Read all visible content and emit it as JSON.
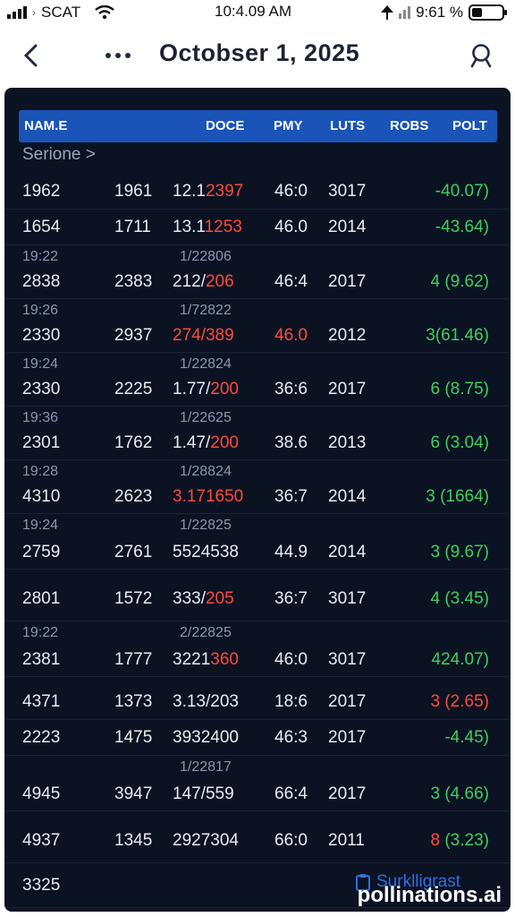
{
  "status_bar": {
    "carrier": "SCAT",
    "time": "10:4.09 AM",
    "battery_text": "9:61 %",
    "battery_level": 0.35
  },
  "nav": {
    "title": "Octobser 1, 2025"
  },
  "table": {
    "columns": [
      "NAM.E",
      "DOCE",
      "PMY",
      "LUTS",
      "ROBS",
      "POLT"
    ],
    "section_label": "Serione >",
    "rows": [
      {
        "time": "",
        "sub": "",
        "name": "1962",
        "col2": "1961",
        "price_a": "12.1",
        "price_b": "2397",
        "price_b_red": true,
        "pmy": "46:0",
        "pmy_red": false,
        "luts": "3017",
        "polt_a": "",
        "polt_b": "-40.07)",
        "polt_b_color": "green"
      },
      {
        "time": "",
        "sub": "",
        "name": "1654",
        "col2": "1711",
        "price_a": "13.1",
        "price_b": "1253",
        "price_b_red": true,
        "pmy": "46.0",
        "pmy_red": false,
        "luts": "2014",
        "polt_a": "",
        "polt_b": "-43.64)",
        "polt_b_color": "green"
      },
      {
        "time": "19:22",
        "sub": "1/22806",
        "name": "2838",
        "col2": "2383",
        "price_a": "212/",
        "price_b": "206",
        "price_b_red": true,
        "pmy": "46:4",
        "pmy_red": false,
        "luts": "2017",
        "polt_a": "4",
        "polt_a_color": "green",
        "polt_b": " (9.62)",
        "polt_b_color": "green"
      },
      {
        "time": "19:26",
        "sub": "1/72822",
        "name": "2330",
        "col2": "2937",
        "price_a": "",
        "price_b": "274/389",
        "price_b_red": true,
        "pmy": "46.0",
        "pmy_red": true,
        "luts": "2012",
        "polt_a": "3",
        "polt_a_color": "green",
        "polt_b": "(61.46)",
        "polt_b_color": "green"
      },
      {
        "time": "19:24",
        "sub": "1/22824",
        "name": "2330",
        "col2": "2225",
        "price_a": "1.77/",
        "price_b": "200",
        "price_b_red": true,
        "pmy": "36:6",
        "pmy_red": false,
        "luts": "2017",
        "polt_a": "6",
        "polt_a_color": "green",
        "polt_b": " (8.75)",
        "polt_b_color": "green"
      },
      {
        "time": "19:36",
        "sub": "1/22625",
        "name": "2301",
        "col2": "1762",
        "price_a": "1.47/",
        "price_b": "200",
        "price_b_red": true,
        "pmy": "38.6",
        "pmy_red": false,
        "luts": "2013",
        "polt_a": "6",
        "polt_a_color": "green",
        "polt_b": " (3.04)",
        "polt_b_color": "green"
      },
      {
        "time": "19:28",
        "sub": "1/28824",
        "name": "4310",
        "col2": "2623",
        "price_a": "",
        "price_b": "3.171650",
        "price_b_red": true,
        "pmy": "36:7",
        "pmy_red": false,
        "luts": "2014",
        "polt_a": "3",
        "polt_a_color": "green",
        "polt_b": " (1664)",
        "polt_b_color": "green"
      },
      {
        "time": "19:24",
        "sub": "1/22825",
        "name": "2759",
        "col2": "2761",
        "price_a": "5524538",
        "price_b": "",
        "price_b_red": false,
        "pmy": "44.9",
        "pmy_red": false,
        "luts": "2014",
        "polt_a": "3",
        "polt_a_color": "green",
        "polt_b": " (9.67)",
        "polt_b_color": "green"
      },
      {
        "time": "",
        "sub": "",
        "name": "2801",
        "col2": "1572",
        "price_a": "333/",
        "price_b": "205",
        "price_b_red": true,
        "pmy": "36:7",
        "pmy_red": false,
        "luts": "3017",
        "polt_a": "4",
        "polt_a_color": "green",
        "polt_b": " (3.45)",
        "polt_b_color": "green"
      },
      {
        "time": "19:22",
        "sub": "2/22825",
        "name": "2381",
        "col2": "1777",
        "price_a": "3221",
        "price_b": "360",
        "price_b_red": true,
        "pmy": "46:0",
        "pmy_red": false,
        "luts": "3017",
        "polt_a": "",
        "polt_b": "424.07)",
        "polt_b_color": "green"
      },
      {
        "time": "",
        "sub": "",
        "name": "4371",
        "col2": "1373",
        "price_a": "3.13/203",
        "price_b": "",
        "price_b_red": false,
        "pmy": "18:6",
        "pmy_red": false,
        "luts": "2017",
        "polt_a": "3",
        "polt_a_color": "red",
        "polt_b": " (2.65)",
        "polt_b_color": "red"
      },
      {
        "time": "",
        "sub": "",
        "name": "2223",
        "col2": "1475",
        "price_a": "3932400",
        "price_b": "",
        "price_b_red": false,
        "pmy": "46:3",
        "pmy_red": false,
        "luts": "2017",
        "polt_a": "",
        "polt_b": "-4.45)",
        "polt_b_color": "green"
      },
      {
        "time": "",
        "sub": "1/22817",
        "name": "4945",
        "col2": "3947",
        "price_a": "147/559",
        "price_b": "",
        "price_b_red": false,
        "pmy": "66:4",
        "pmy_red": false,
        "luts": "2017",
        "polt_a": "3",
        "polt_a_color": "green",
        "polt_b": " (4.66)",
        "polt_b_color": "green"
      },
      {
        "time": "",
        "sub": "",
        "name": "4937",
        "col2": "1345",
        "price_a": "2927304",
        "price_b": "",
        "price_b_red": false,
        "pmy": "66:0",
        "pmy_red": false,
        "luts": "2011",
        "polt_a": "8",
        "polt_a_color": "red",
        "polt_b": " (3.23)",
        "polt_b_color": "green"
      },
      {
        "time": "",
        "sub": "",
        "name": "3325",
        "col2": "",
        "price_a": "",
        "price_b": "",
        "price_b_red": false,
        "pmy": "",
        "pmy_red": false,
        "luts": "",
        "polt_a": "",
        "polt_b": "",
        "polt_b_color": "green"
      }
    ]
  },
  "footer": {
    "link_label": "Surklligrast",
    "watermark": "pollinations.ai"
  },
  "colors": {
    "card_bg": "#0b1323",
    "header_blue": "#1a54b8",
    "gain_green": "#3fcf5c",
    "loss_red": "#ff4a3a"
  }
}
